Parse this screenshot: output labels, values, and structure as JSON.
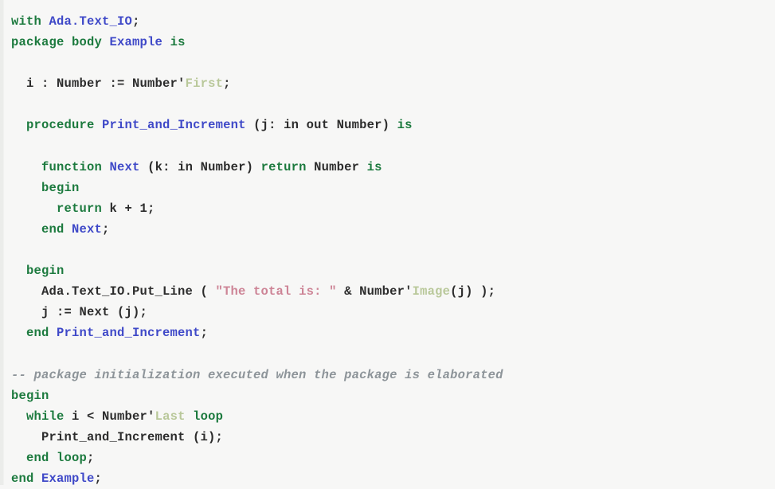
{
  "document": {
    "kind": "source-code-listing",
    "language": "Ada",
    "background_color": "#f7f7f6",
    "colors": {
      "keyword": "#1c7a3e",
      "identifier": "#3f49c8",
      "plain": "#2c2c2c",
      "attribute": "#b9c89a",
      "string": "#cd8496",
      "comment": "#8d9499"
    }
  },
  "code": {
    "lines": [
      {
        "id": "line-1",
        "indent": 0,
        "tokens": [
          {
            "t": "with",
            "c": "kw"
          },
          {
            "t": " ",
            "c": "plain"
          },
          {
            "t": "Ada.Text_IO",
            "c": "id"
          },
          {
            "t": ";",
            "c": "plain"
          }
        ]
      },
      {
        "id": "line-2",
        "indent": 0,
        "tokens": [
          {
            "t": "package body",
            "c": "kw"
          },
          {
            "t": " ",
            "c": "plain"
          },
          {
            "t": "Example",
            "c": "id"
          },
          {
            "t": " ",
            "c": "plain"
          },
          {
            "t": "is",
            "c": "kw"
          }
        ]
      },
      {
        "id": "line-3",
        "indent": 0,
        "tokens": [
          {
            "t": "",
            "c": "plain"
          }
        ]
      },
      {
        "id": "line-4",
        "indent": 2,
        "tokens": [
          {
            "t": "i : Number := Number",
            "c": "plain"
          },
          {
            "t": "'",
            "c": "plain"
          },
          {
            "t": "First",
            "c": "attr"
          },
          {
            "t": ";",
            "c": "plain"
          }
        ]
      },
      {
        "id": "line-5",
        "indent": 0,
        "tokens": [
          {
            "t": "",
            "c": "plain"
          }
        ]
      },
      {
        "id": "line-6",
        "indent": 2,
        "tokens": [
          {
            "t": "procedure",
            "c": "kw"
          },
          {
            "t": " ",
            "c": "plain"
          },
          {
            "t": "Print_and_Increment",
            "c": "id"
          },
          {
            "t": " (j: in out Number) ",
            "c": "plain"
          },
          {
            "t": "is",
            "c": "kw"
          }
        ]
      },
      {
        "id": "line-7",
        "indent": 0,
        "tokens": [
          {
            "t": "",
            "c": "plain"
          }
        ]
      },
      {
        "id": "line-8",
        "indent": 4,
        "tokens": [
          {
            "t": "function",
            "c": "kw"
          },
          {
            "t": " ",
            "c": "plain"
          },
          {
            "t": "Next",
            "c": "id"
          },
          {
            "t": " (k: in Number) ",
            "c": "plain"
          },
          {
            "t": "return",
            "c": "kw"
          },
          {
            "t": " Number ",
            "c": "plain"
          },
          {
            "t": "is",
            "c": "kw"
          }
        ]
      },
      {
        "id": "line-9",
        "indent": 4,
        "tokens": [
          {
            "t": "begin",
            "c": "kw"
          }
        ]
      },
      {
        "id": "line-10",
        "indent": 6,
        "tokens": [
          {
            "t": "return",
            "c": "kw"
          },
          {
            "t": " k + 1;",
            "c": "plain"
          }
        ]
      },
      {
        "id": "line-11",
        "indent": 4,
        "tokens": [
          {
            "t": "end",
            "c": "kw"
          },
          {
            "t": " ",
            "c": "plain"
          },
          {
            "t": "Next",
            "c": "id"
          },
          {
            "t": ";",
            "c": "plain"
          }
        ]
      },
      {
        "id": "line-12",
        "indent": 0,
        "tokens": [
          {
            "t": "",
            "c": "plain"
          }
        ]
      },
      {
        "id": "line-13",
        "indent": 2,
        "tokens": [
          {
            "t": "begin",
            "c": "kw"
          }
        ]
      },
      {
        "id": "line-14",
        "indent": 4,
        "tokens": [
          {
            "t": "Ada.Text_IO.Put_Line ( ",
            "c": "plain"
          },
          {
            "t": "\"The total is: \"",
            "c": "str"
          },
          {
            "t": " & Number",
            "c": "plain"
          },
          {
            "t": "'",
            "c": "plain"
          },
          {
            "t": "Image",
            "c": "attr"
          },
          {
            "t": "(j) );",
            "c": "plain"
          }
        ]
      },
      {
        "id": "line-15",
        "indent": 4,
        "tokens": [
          {
            "t": "j := Next (j);",
            "c": "plain"
          }
        ]
      },
      {
        "id": "line-16",
        "indent": 2,
        "tokens": [
          {
            "t": "end",
            "c": "kw"
          },
          {
            "t": " ",
            "c": "plain"
          },
          {
            "t": "Print_and_Increment",
            "c": "id"
          },
          {
            "t": ";",
            "c": "plain"
          }
        ]
      },
      {
        "id": "line-17",
        "indent": 0,
        "tokens": [
          {
            "t": "",
            "c": "plain"
          }
        ]
      },
      {
        "id": "line-18",
        "indent": 0,
        "tokens": [
          {
            "t": "-- package initialization executed when the package is elaborated",
            "c": "comment"
          }
        ]
      },
      {
        "id": "line-19",
        "indent": 0,
        "tokens": [
          {
            "t": "begin",
            "c": "kw"
          }
        ]
      },
      {
        "id": "line-20",
        "indent": 2,
        "tokens": [
          {
            "t": "while",
            "c": "kw"
          },
          {
            "t": " i < Number",
            "c": "plain"
          },
          {
            "t": "'",
            "c": "plain"
          },
          {
            "t": "Last",
            "c": "attr"
          },
          {
            "t": " ",
            "c": "plain"
          },
          {
            "t": "loop",
            "c": "kw"
          }
        ]
      },
      {
        "id": "line-21",
        "indent": 4,
        "tokens": [
          {
            "t": "Print_and_Increment (i);",
            "c": "plain"
          }
        ]
      },
      {
        "id": "line-22",
        "indent": 2,
        "tokens": [
          {
            "t": "end loop",
            "c": "kw"
          },
          {
            "t": ";",
            "c": "plain"
          }
        ]
      },
      {
        "id": "line-23",
        "indent": 0,
        "tokens": [
          {
            "t": "end",
            "c": "kw"
          },
          {
            "t": " ",
            "c": "plain"
          },
          {
            "t": "Example",
            "c": "id"
          },
          {
            "t": ";",
            "c": "plain"
          }
        ]
      }
    ]
  }
}
